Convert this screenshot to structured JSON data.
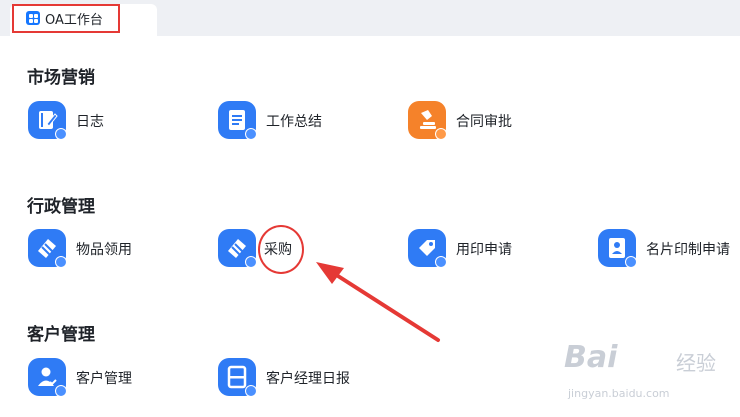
{
  "tab": {
    "title": "OA工作台",
    "icon": "grid-app-icon"
  },
  "accent_color": "#2f7bf5",
  "highlight_color": "#e53935",
  "sections": [
    {
      "title": "市场营销",
      "apps": [
        {
          "label": "日志",
          "icon": "diary-icon",
          "color": "#2f7bf5"
        },
        {
          "label": "工作总结",
          "icon": "document-icon",
          "color": "#2f7bf5"
        },
        {
          "label": "合同审批",
          "icon": "stamp-icon",
          "color": "#f5822a"
        }
      ]
    },
    {
      "title": "行政管理",
      "apps": [
        {
          "label": "物品领用",
          "icon": "package-icon",
          "color": "#2f7bf5"
        },
        {
          "label": "采购",
          "icon": "package-icon",
          "color": "#2f7bf5"
        },
        {
          "label": "用印申请",
          "icon": "tag-icon",
          "color": "#2f7bf5"
        },
        {
          "label": "名片印制申请",
          "icon": "business-card-icon",
          "color": "#2f7bf5"
        }
      ]
    },
    {
      "title": "客户管理",
      "apps": [
        {
          "label": "客户管理",
          "icon": "customer-icon",
          "color": "#2f7bf5"
        },
        {
          "label": "客户经理日报",
          "icon": "report-icon",
          "color": "#2f7bf5"
        }
      ]
    }
  ],
  "watermark": {
    "brand": "Bai",
    "brand_cn": "经验",
    "url": "jingyan.baidu.com"
  }
}
